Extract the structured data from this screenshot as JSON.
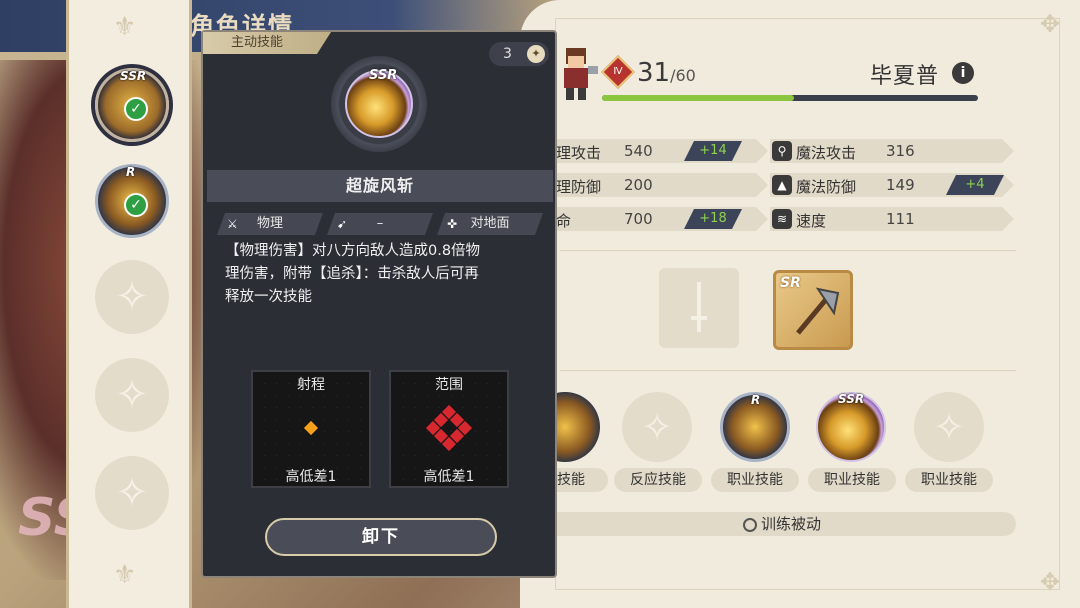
{
  "header": {
    "title": "角色详情"
  },
  "popup": {
    "tab_label": "主动技能",
    "cost": "3",
    "cost_icon": "coin-icon",
    "rarity": "SSR",
    "skill_name": "超旋风斩",
    "tags": [
      {
        "icon": "sword-icon",
        "label": "物理"
      },
      {
        "icon": "bow-icon",
        "label": "–"
      },
      {
        "icon": "ground-target-icon",
        "label": "对地面"
      }
    ],
    "description_lines": [
      "【物理伤害】对八方向敌人造成0.8倍物",
      "理伤害，附带【追杀】：击杀敌人后可再",
      "释放一次技能"
    ],
    "range_box": {
      "title": "射程",
      "footer": "高低差1"
    },
    "area_box": {
      "title": "范围",
      "footer": "高低差1"
    },
    "unequip_label": "卸下"
  },
  "slots": [
    {
      "rarity": "SSR",
      "equipped": true
    },
    {
      "rarity": "R",
      "equipped": true
    },
    {
      "rarity": "",
      "equipped": false
    },
    {
      "rarity": "",
      "equipped": false
    },
    {
      "rarity": "",
      "equipped": false
    }
  ],
  "hero": {
    "level_badge": "Ⅳ",
    "level": "31",
    "level_max": "/60",
    "name": "毕夏普",
    "xp_fraction": 0.51
  },
  "stats": {
    "phys_atk": {
      "label": "理攻击",
      "value": "540",
      "bonus": "+14"
    },
    "phys_def": {
      "label": "理防御",
      "value": "200"
    },
    "hp": {
      "label": "命",
      "value": "700",
      "bonus": "+18"
    },
    "mag_atk": {
      "label": "魔法攻击",
      "value": "316"
    },
    "mag_def": {
      "label": "魔法防御",
      "value": "149",
      "bonus": "+4"
    },
    "speed": {
      "label": "速度",
      "value": "111"
    }
  },
  "equipment": {
    "weapon_rarity": "SR"
  },
  "skills": [
    {
      "label": "攻技能",
      "rarity": "R"
    },
    {
      "label": "反应技能",
      "rarity": ""
    },
    {
      "label": "职业技能",
      "rarity": "R"
    },
    {
      "label": "职业技能",
      "rarity": "SSR"
    },
    {
      "label": "职业技能",
      "rarity": ""
    }
  ],
  "train_passive_label": "训练被动",
  "colors": {
    "accent_green": "#8cc63f",
    "panel_dark": "#2c2e36",
    "panel_light": "#f1ebdd",
    "range_orange": "#f5a01a",
    "area_red": "#d7282f"
  }
}
